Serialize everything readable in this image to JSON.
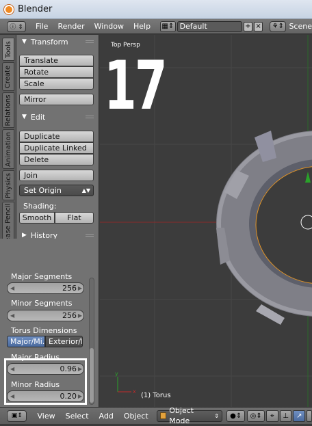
{
  "window": {
    "title": "Blender"
  },
  "menubar": {
    "items": [
      "File",
      "Render",
      "Window",
      "Help"
    ],
    "layout": "Default",
    "scene": "Scene"
  },
  "tabs": [
    "Tools",
    "Create",
    "Relations",
    "Animation",
    "Physics",
    "Grease Pencil"
  ],
  "toolshelf": {
    "transform": {
      "title": "Transform",
      "buttons": [
        "Translate",
        "Rotate",
        "Scale"
      ],
      "mirror": "Mirror"
    },
    "edit": {
      "title": "Edit",
      "buttons": [
        "Duplicate",
        "Duplicate Linked",
        "Delete"
      ],
      "join": "Join",
      "set_origin": "Set Origin"
    },
    "shading": {
      "label": "Shading:",
      "smooth": "Smooth",
      "flat": "Flat"
    },
    "history": {
      "title": "History"
    }
  },
  "operator": {
    "major_segments": {
      "label": "Major Segments",
      "value": "256"
    },
    "minor_segments": {
      "label": "Minor Segments",
      "value": "256"
    },
    "torus_dimensions": {
      "label": "Torus Dimensions",
      "options": [
        "Major/Mi...",
        "Exterior/I..."
      ]
    },
    "major_radius": {
      "label": "Major Radius",
      "value": "0.96"
    },
    "minor_radius": {
      "label": "Minor Radius",
      "value": "0.20"
    }
  },
  "viewport": {
    "view_label": "Top Persp",
    "object_label": "(1) Torus",
    "overlay_number": "17",
    "colors": {
      "background": "#3c3c3c",
      "grid": "#474747",
      "x_axis": "#8a2a2a",
      "y_axis": "#2a8a2a",
      "selection": "#e39424"
    }
  },
  "bottombar": {
    "items": [
      "View",
      "Select",
      "Add",
      "Object"
    ],
    "mode": "Object Mode"
  }
}
